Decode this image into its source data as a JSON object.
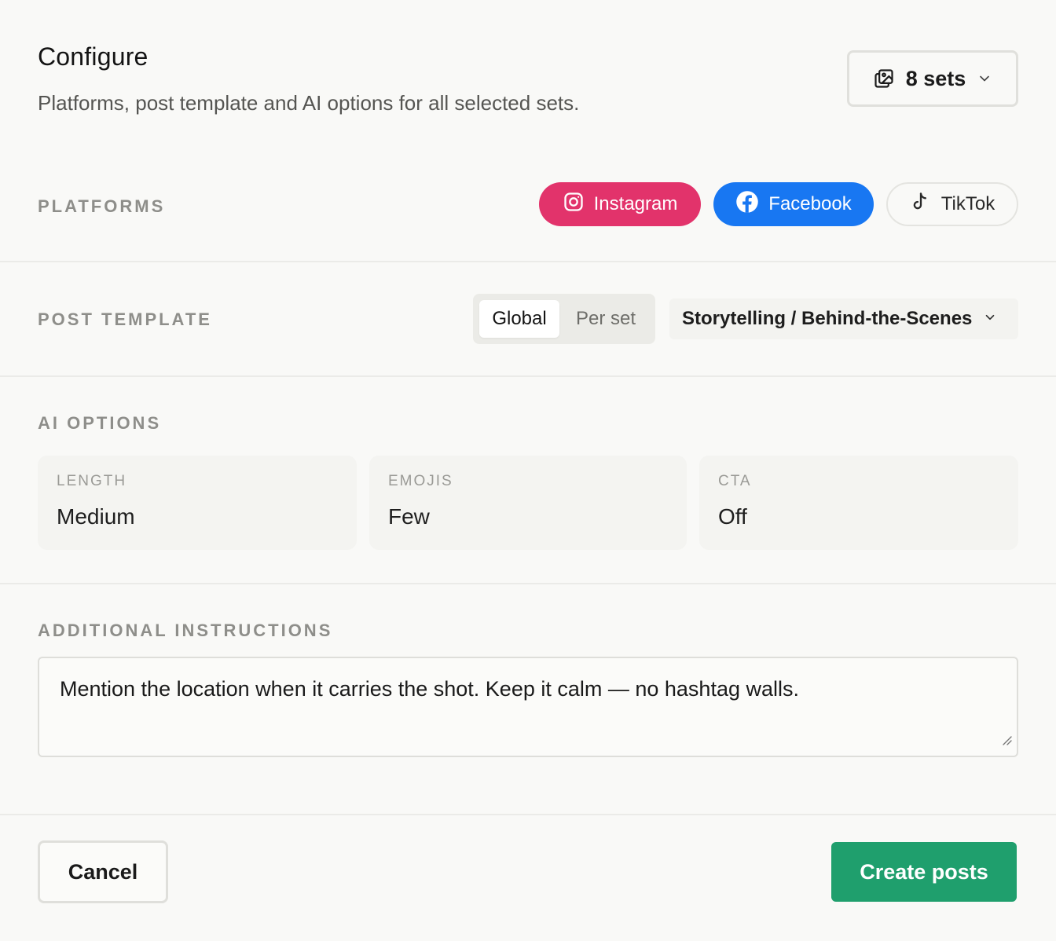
{
  "header": {
    "title": "Configure",
    "subtitle": "Platforms, post template and AI options for all selected sets.",
    "sets_button": {
      "label": "8 sets",
      "icon": "image-stack-icon"
    }
  },
  "platforms": {
    "label": "PLATFORMS",
    "items": [
      {
        "label": "Instagram",
        "icon": "instagram-icon",
        "selected": true,
        "color": "#e2336b"
      },
      {
        "label": "Facebook",
        "icon": "facebook-icon",
        "selected": true,
        "color": "#1877f2"
      },
      {
        "label": "TikTok",
        "icon": "tiktok-icon",
        "selected": false,
        "color": "#f9f9f7"
      }
    ]
  },
  "post_template": {
    "label": "POST TEMPLATE",
    "scope_options": [
      "Global",
      "Per set"
    ],
    "scope_selected": "Global",
    "template_selected": "Storytelling / Behind-the-Scenes"
  },
  "ai_options": {
    "label": "AI OPTIONS",
    "length": {
      "label": "LENGTH",
      "value": "Medium"
    },
    "emojis": {
      "label": "EMOJIS",
      "value": "Few"
    },
    "cta": {
      "label": "CTA",
      "value": "Off"
    }
  },
  "instructions": {
    "label": "ADDITIONAL INSTRUCTIONS",
    "value": "Mention the location when it carries the shot. Keep it calm — no hashtag walls."
  },
  "footer": {
    "cancel_label": "Cancel",
    "create_label": "Create posts",
    "create_color": "#1f9f6d"
  }
}
